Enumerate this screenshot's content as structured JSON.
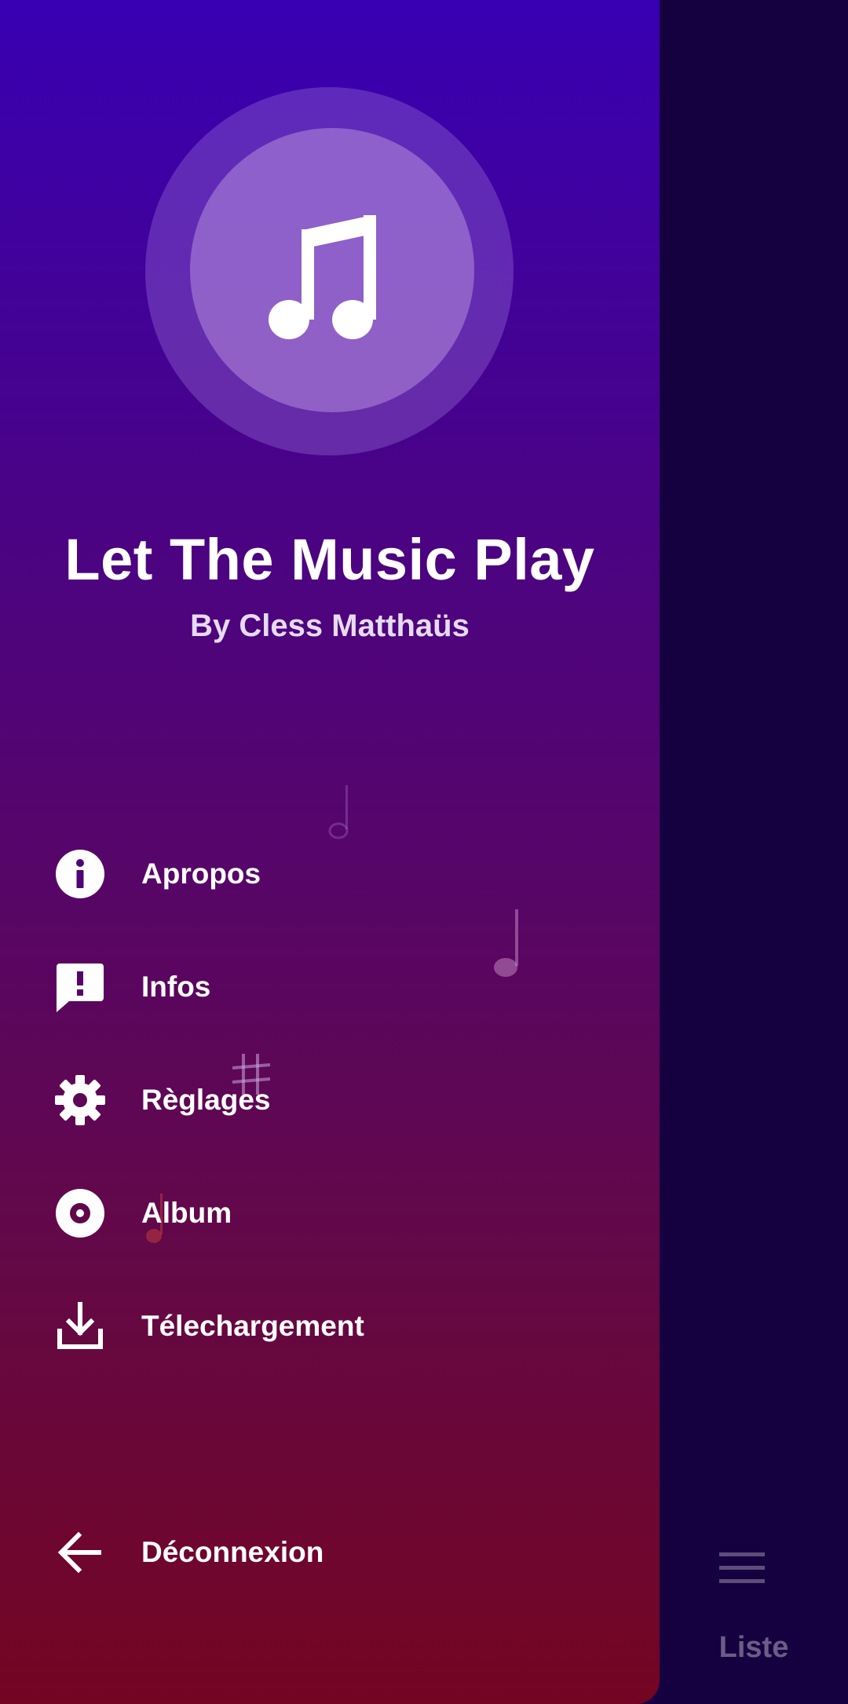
{
  "app": {
    "title": "Let The Music Play",
    "subtitle": "By Cless Matthaüs",
    "logo_icon": "music-note-icon"
  },
  "menu": {
    "items": [
      {
        "label": "Apropos",
        "icon": "info-icon"
      },
      {
        "label": "Infos",
        "icon": "feedback-icon"
      },
      {
        "label": "Règlages",
        "icon": "gear-icon"
      },
      {
        "label": "Album",
        "icon": "album-disc-icon"
      },
      {
        "label": "Télechargement",
        "icon": "download-icon"
      }
    ],
    "logout": {
      "label": "Déconnexion",
      "icon": "arrow-left-icon"
    }
  },
  "bottom_nav": {
    "list_label": "Liste",
    "list_icon": "hamburger-menu-icon"
  },
  "colors": {
    "drawer_top": "#3800b3",
    "drawer_bottom": "#740522",
    "background": "#150140",
    "text": "#ffffff",
    "muted_label": "#6e5b86"
  }
}
